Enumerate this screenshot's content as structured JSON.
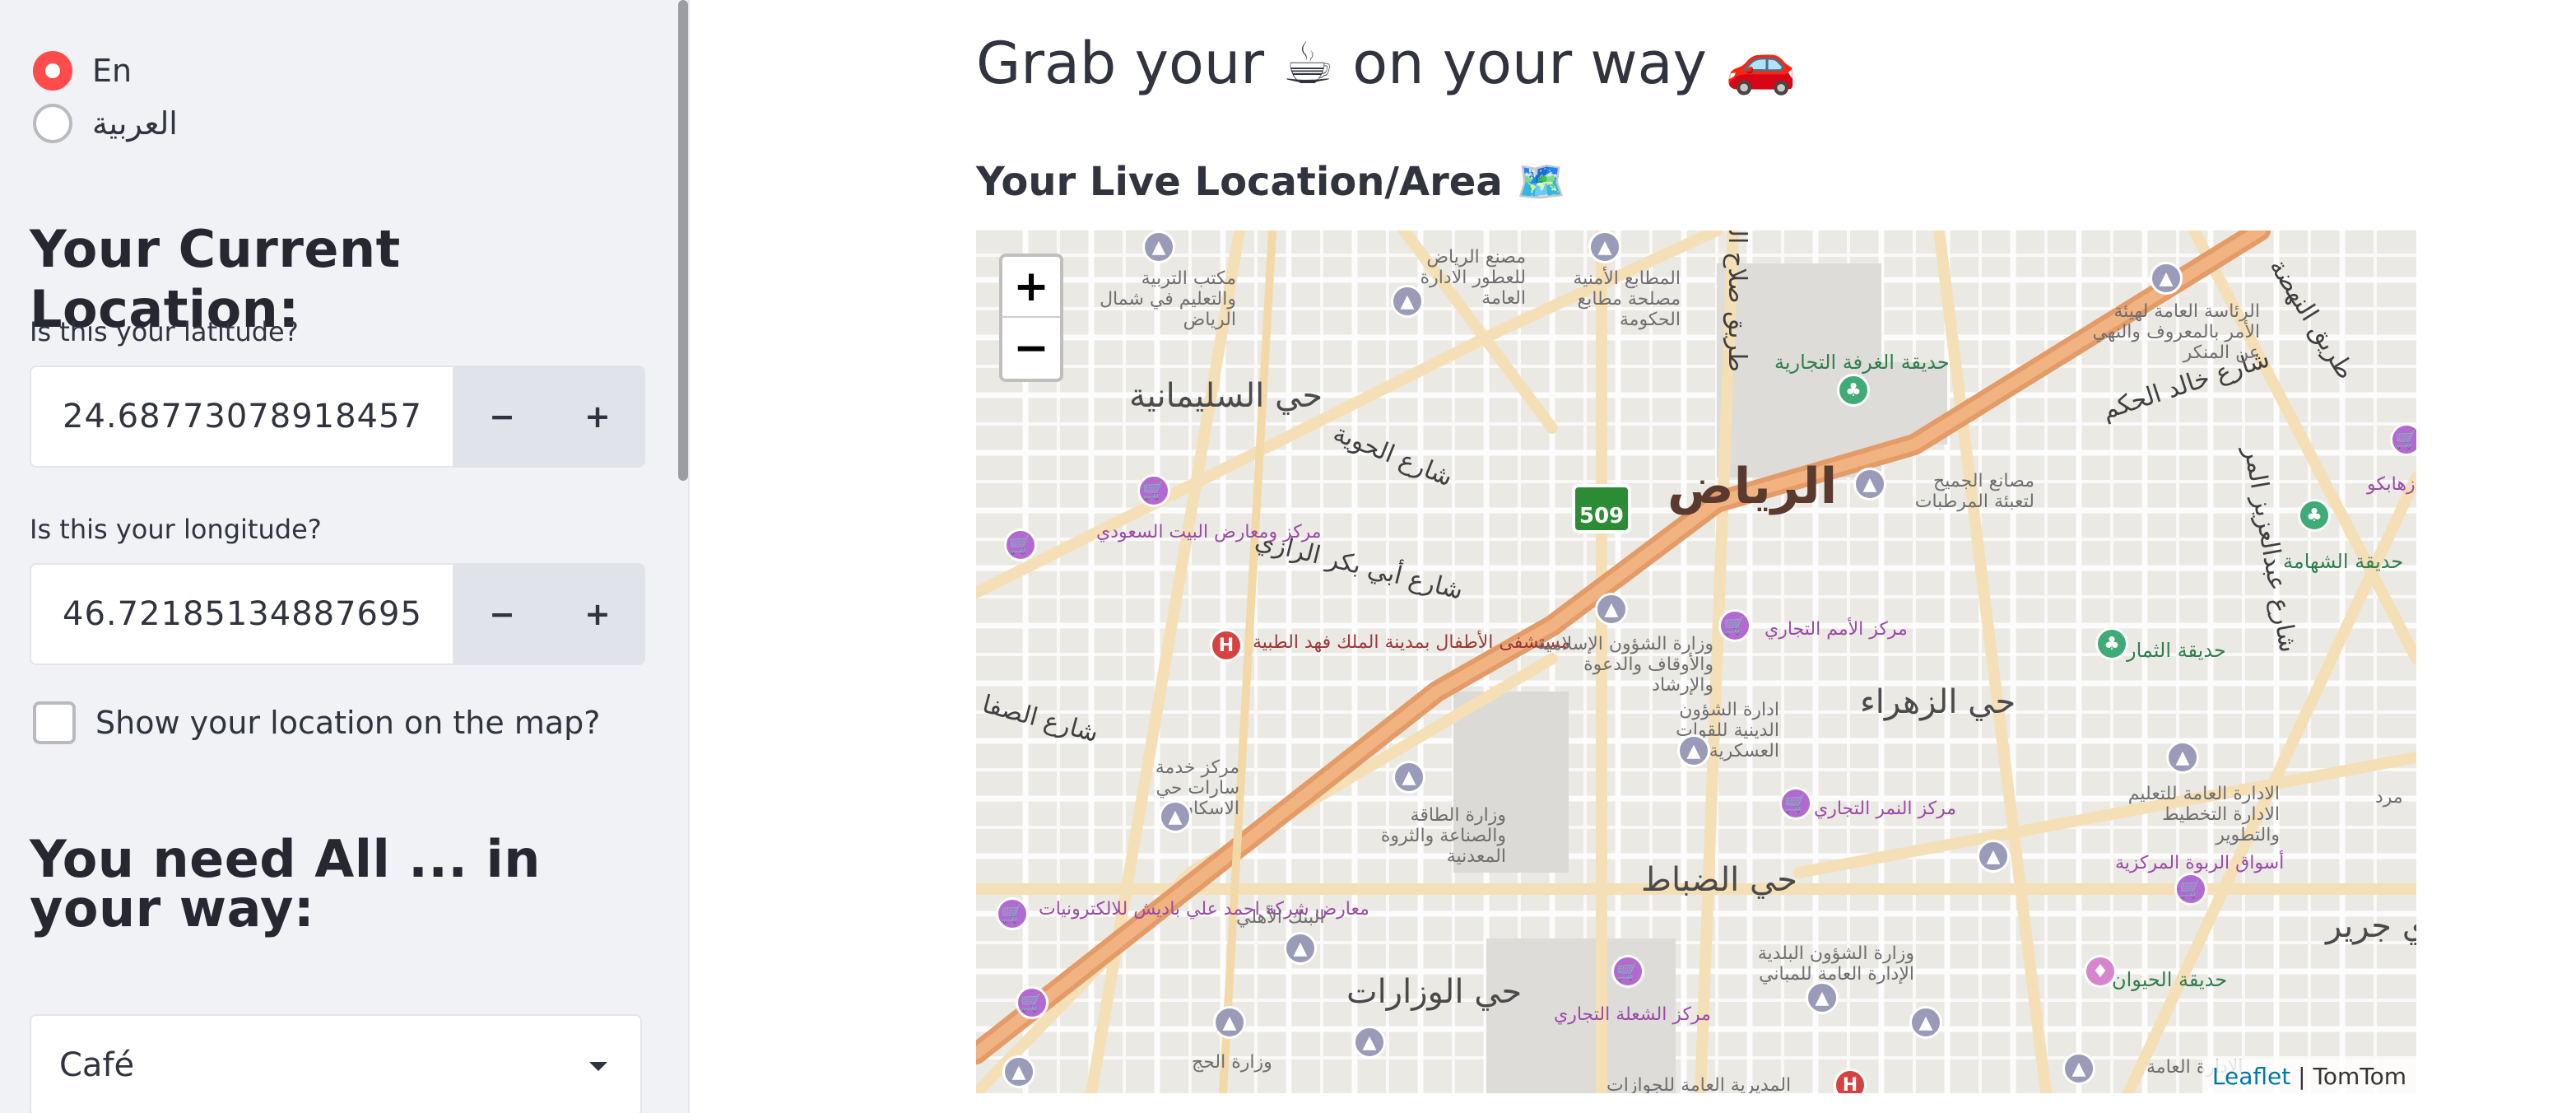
{
  "sidebar": {
    "languages": [
      {
        "label": "En",
        "selected": true
      },
      {
        "label": "العربية",
        "selected": false
      }
    ],
    "location_header": "Your Current Location:",
    "latitude": {
      "label": "Is this your latitude?",
      "value": "24.68773078918457",
      "minus": "−",
      "plus": "+"
    },
    "longitude": {
      "label": "Is this your longitude?",
      "value": "46.72185134887695",
      "minus": "−",
      "plus": "+"
    },
    "show_on_map": {
      "label": "Show your location on the map?",
      "checked": false
    },
    "need_header": "You need All ... in your way:",
    "category_select": {
      "value": "Café"
    }
  },
  "main": {
    "title": "Grab your ☕ on your way 🚗",
    "subtitle": "Your Live Location/Area 🗺️"
  },
  "map": {
    "zoom_in": "+",
    "zoom_out": "−",
    "attribution": {
      "leaflet": "Leaflet",
      "separator": " | ",
      "provider": "TomTom"
    },
    "route_shield": "509",
    "labels": {
      "city": "الرياض",
      "sulaimaniyah": "حي السليمانية",
      "zahra": "حي الزهراء",
      "dhubbat": "حي الضباط",
      "wizarat": "حي الوزارات",
      "jarir": "ي جرير",
      "st_hawiyah": "شارع الحوية",
      "st_razi": "شارع أبي بكر الرازي",
      "st_safa": "شارع الصفا",
      "st_salah": "طريق صلاح الد",
      "st_nahdah": "طريق النهضة",
      "st_khalid": "شارع خالد الحكم",
      "st_abdulaziz": "شارع عبدالعزيز المر",
      "chamber_park": "حديقة الغرفة التجارية",
      "shahama_park": "حديقة الشهامة",
      "thimar_park": "حديقة الثمار",
      "animals_park": "حديقة الحيوان",
      "umam_center": "مركز الأمم التجاري",
      "nimr_center": "مركز النمر التجاري",
      "shula_center": "مركز الشعلة التجاري",
      "rabwa_markets": "أسواق الربوة المركزية",
      "hospital": "مستشفى الأطفال بمدينة الملك فهد الطبية",
      "ahli_bank": "البنك الأهلي",
      "hajj_ministry": "وزارة الحج",
      "passports": "المديرية العامة للجوازات",
      "islamic_affairs": "وزارة الشؤون الإسلامية والأوقاف والدعوة والإرشاد",
      "energy": "وزارة الطاقة والصناعة والثروة المعدنية",
      "religious_affairs": "ادارة الشؤون الدينية للقوات العسكرية",
      "municipal": "وزارة الشؤون البلدية الإدارة العامة للمباني",
      "gov_printing": "المطابع الأمنية مصلحة مطابع الحكومة",
      "riyadh_factory": "مصنع الرياض للعطور الادارة العامة",
      "education": "مكتب التربية والتعليم في شمال الرياض",
      "saudi_home": "مركز ومعارض البيت السعودي",
      "iskan": "مركز خدمة سارات حي الاسكان",
      "electronics": "معارض شركة احمد علي باديش للالكترونيات",
      "jamih": "مصانع الجميح لتعبئة المرطبات",
      "hay_amr": "الرئاسة العامة لهيئة الأمر بالمعروف والنهي عن المنكر",
      "planning": "الادارة العامة للتعليم الادارة التخطيط والتطوير",
      "zahabko": "زهابكو",
      "morad": "مرد",
      "general_admin": "الإدارة العامة"
    }
  }
}
